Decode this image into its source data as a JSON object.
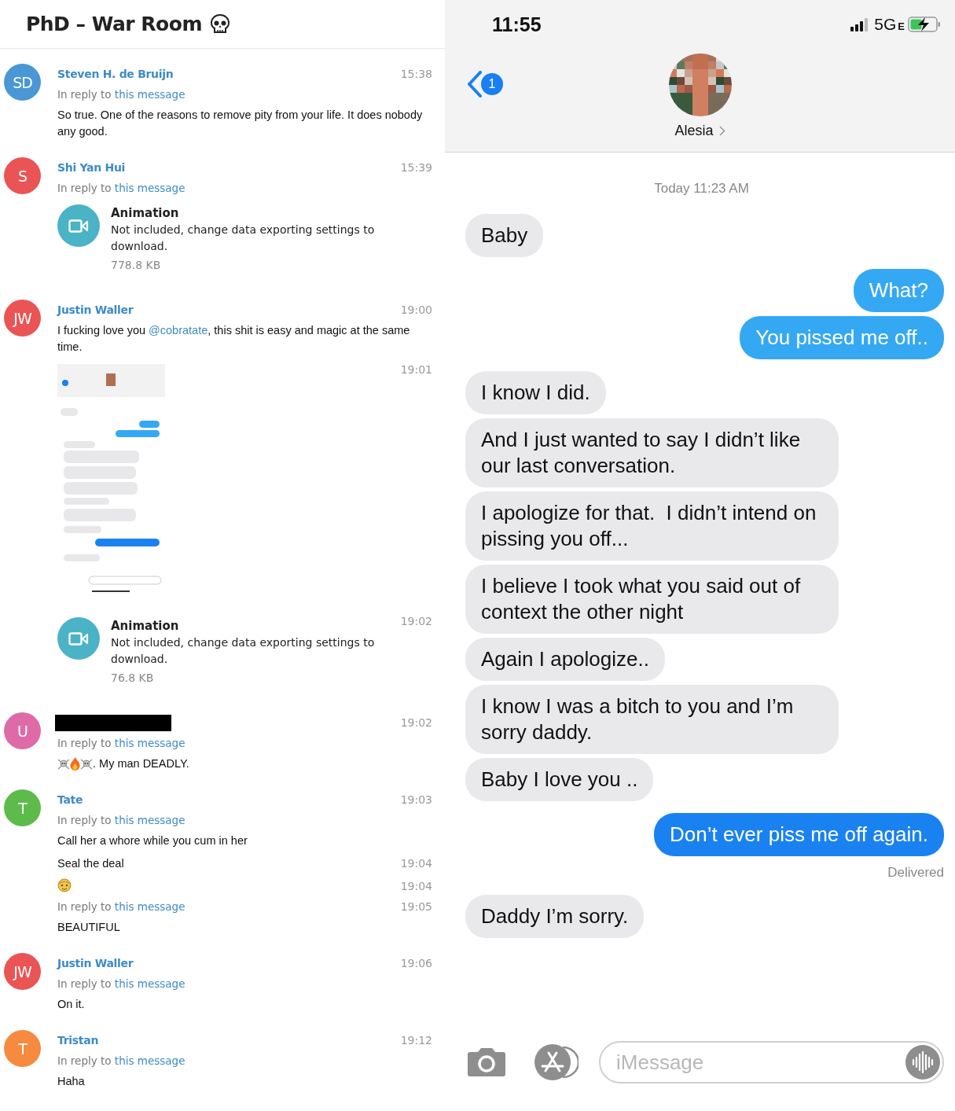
{
  "group_chat": {
    "title": "PhD – War Room",
    "groups": [
      {
        "initials": "SD",
        "color": "#4a97d6",
        "name": "Steven H. de Bruijn",
        "messages": [
          {
            "time": "15:38",
            "reply": {
              "prefix": "In reply to",
              "link": "this message"
            },
            "kind": "text",
            "segments": [
              {
                "kind": "plain",
                "text": "So true. One of the reasons to remove pity from your life. It does nobody any good."
              }
            ]
          }
        ]
      },
      {
        "initials": "S",
        "color": "#ea5455",
        "name": "Shi Yan Hui",
        "messages": [
          {
            "time": "15:39",
            "reply": {
              "prefix": "In reply to",
              "link": "this message"
            },
            "kind": "animation",
            "title": "Animation",
            "note": "Not included, change data exporting settings to download.",
            "size": "778.8 KB"
          }
        ]
      },
      {
        "initials": "JW",
        "color": "#ea5455",
        "name": "Justin Waller",
        "messages": [
          {
            "time": "19:00",
            "kind": "text",
            "segments": [
              {
                "kind": "plain",
                "text": "I fucking love you "
              },
              {
                "kind": "mention",
                "text": "@cobratate"
              },
              {
                "kind": "plain",
                "text": ", this shit is easy and magic at the same time."
              }
            ]
          },
          {
            "time": "19:01",
            "kind": "picture"
          },
          {
            "time": "19:02",
            "kind": "animation",
            "title": "Animation",
            "note": "Not included, change data exporting settings to download.",
            "size": "76.8 KB"
          }
        ]
      },
      {
        "initials": "U",
        "color": "#df6aa8",
        "name_redacted": true,
        "messages": [
          {
            "time": "19:02",
            "reply": {
              "prefix": "In reply to",
              "link": "this message"
            },
            "kind": "emoji_text",
            "segments": [
              {
                "kind": "plain",
                "text": ". My man DEADLY."
              }
            ]
          }
        ]
      },
      {
        "initials": "T",
        "color": "#5dbb4c",
        "name": "Tate",
        "messages": [
          {
            "time": "19:03",
            "reply": {
              "prefix": "In reply to",
              "link": "this message"
            },
            "kind": "text",
            "segments": [
              {
                "kind": "plain",
                "text": "Call her a whore while you cum in her"
              }
            ]
          },
          {
            "time": "19:04",
            "kind": "text",
            "segments": [
              {
                "kind": "plain",
                "text": "Seal the deal"
              }
            ]
          },
          {
            "time": "19:04",
            "kind": "emoji"
          },
          {
            "time": "19:05",
            "reply": {
              "prefix": "In reply to",
              "link": "this message"
            },
            "kind": "text",
            "segments": [
              {
                "kind": "plain",
                "text": "BEAUTIFUL"
              }
            ]
          }
        ]
      },
      {
        "initials": "JW",
        "color": "#ea5455",
        "name": "Justin Waller",
        "messages": [
          {
            "time": "19:06",
            "reply": {
              "prefix": "In reply to",
              "link": "this message"
            },
            "kind": "text",
            "segments": [
              {
                "kind": "plain",
                "text": "On it."
              }
            ]
          }
        ]
      },
      {
        "initials": "T",
        "color": "#f68a3f",
        "name": "Tristan",
        "messages": [
          {
            "time": "19:12",
            "reply": {
              "prefix": "In reply to",
              "link": "this message"
            },
            "kind": "text",
            "segments": [
              {
                "kind": "plain",
                "text": "Haha"
              }
            ]
          }
        ]
      }
    ]
  },
  "phone": {
    "status_bar": {
      "time": "11:55",
      "network": "5G",
      "network_suffix": "E"
    },
    "header": {
      "back_badge": "1",
      "contact": "Alesia"
    },
    "timestamp": "Today 11:23 AM",
    "bubbles": [
      {
        "kind": "received",
        "text": "Baby"
      },
      {
        "kind": "sent",
        "color": "#35a8f4",
        "text": "What?"
      },
      {
        "kind": "sent",
        "color": "#35a8f4",
        "text": "You pissed me off.."
      },
      {
        "kind": "received",
        "text": "I know I did."
      },
      {
        "kind": "received",
        "text": "And I just wanted to say I didn’t like our last conversation."
      },
      {
        "kind": "received",
        "text": "I apologize for that.  I didn’t intend on pissing you off..."
      },
      {
        "kind": "received",
        "text": "I believe I took what you said out of context the other night"
      },
      {
        "kind": "received",
        "text": "Again I apologize.."
      },
      {
        "kind": "received",
        "text": "I know I was a bitch to you and I’m sorry daddy."
      },
      {
        "kind": "received",
        "text": "Baby I love you .."
      },
      {
        "kind": "sent",
        "color": "#1a82f0",
        "text": "Don’t ever piss me off again."
      },
      {
        "kind": "status",
        "text": "Delivered"
      },
      {
        "kind": "received",
        "text": "Daddy I’m sorry."
      }
    ],
    "composer": {
      "placeholder": "iMessage"
    }
  }
}
